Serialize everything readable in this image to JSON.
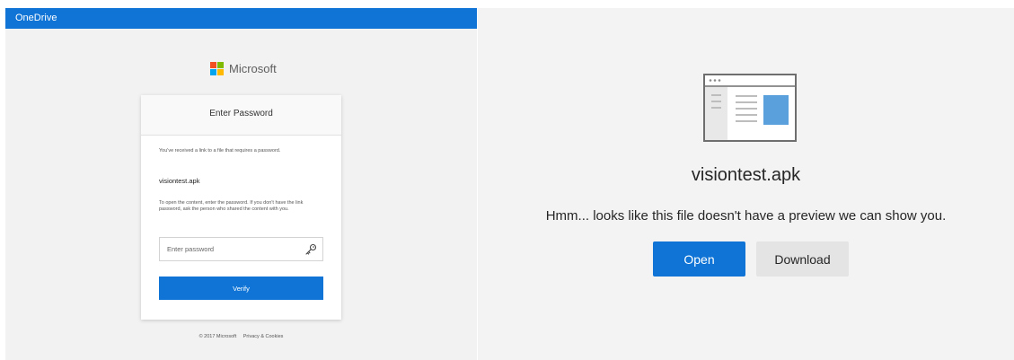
{
  "left_panel": {
    "topbar": {
      "title": "OneDrive"
    },
    "logo": {
      "text": "Microsoft",
      "colors": [
        "#f25022",
        "#7fba00",
        "#00a4ef",
        "#ffb900"
      ]
    },
    "card": {
      "header": "Enter Password",
      "info_text": "You've received a link to a file that requires a password.",
      "filename": "visiontest.apk",
      "instructions": "To open the content, enter the password. If you don't have the link password, ask the person who shared the content with you.",
      "password_field": {
        "placeholder": "Enter password",
        "value": "",
        "icon": "key-icon"
      },
      "verify_label": "Verify"
    },
    "footer": {
      "copyright": "© 2017 Microsoft",
      "privacy": "Privacy & Cookies"
    }
  },
  "right_panel": {
    "icon": "document-preview-icon",
    "filename": "visiontest.apk",
    "message": "Hmm... looks like this file doesn't have a preview we can show you.",
    "open_label": "Open",
    "download_label": "Download"
  },
  "colors": {
    "accent": "#0f74d6",
    "background": "#f3f3f3",
    "secondary_button": "#e4e4e4"
  }
}
